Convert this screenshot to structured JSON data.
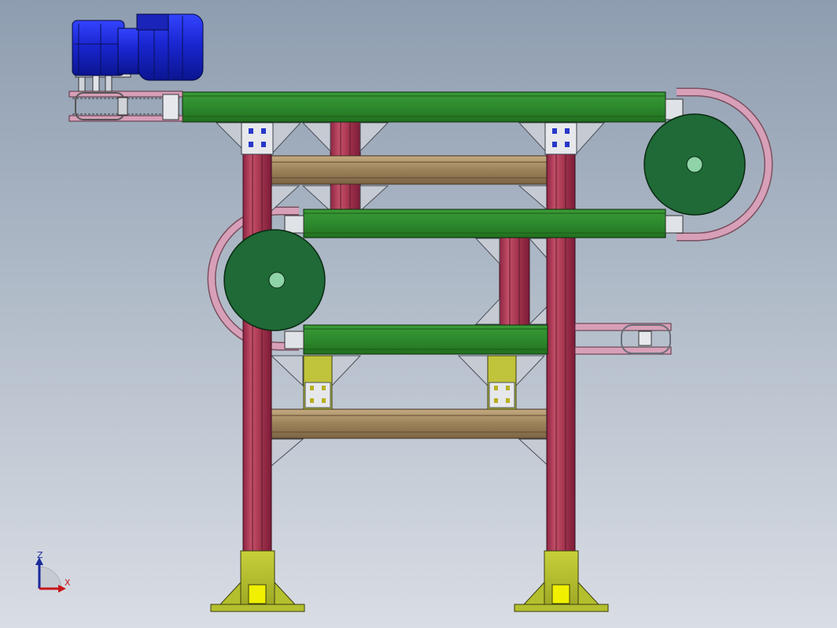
{
  "view": {
    "type": "3D CAD model — front view of a belt conveyor assembly",
    "background_top": "#8e9db0",
    "background_bottom": "#d9dde4"
  },
  "triad": {
    "z_label": "Z",
    "x_label": "X",
    "z_color": "#1a2a9c",
    "x_color": "#c8151b"
  },
  "colors": {
    "conveyor_belt": "#2f8a2f",
    "pulley": "#1f6a36",
    "frame_leg": "#b23a56",
    "cross_beam": "#a0865e",
    "base_plate": "#b4bf2e",
    "motor": "#1f2fd6",
    "belt_loop": "#d7a0b8",
    "bracket": "#c6cbd3"
  },
  "components": [
    "motor-gearbox",
    "upper-conveyor",
    "middle-conveyor",
    "lower-conveyor",
    "drive-pulley-right",
    "return-pulley-left",
    "frame-legs",
    "cross-beams",
    "base-plates"
  ]
}
